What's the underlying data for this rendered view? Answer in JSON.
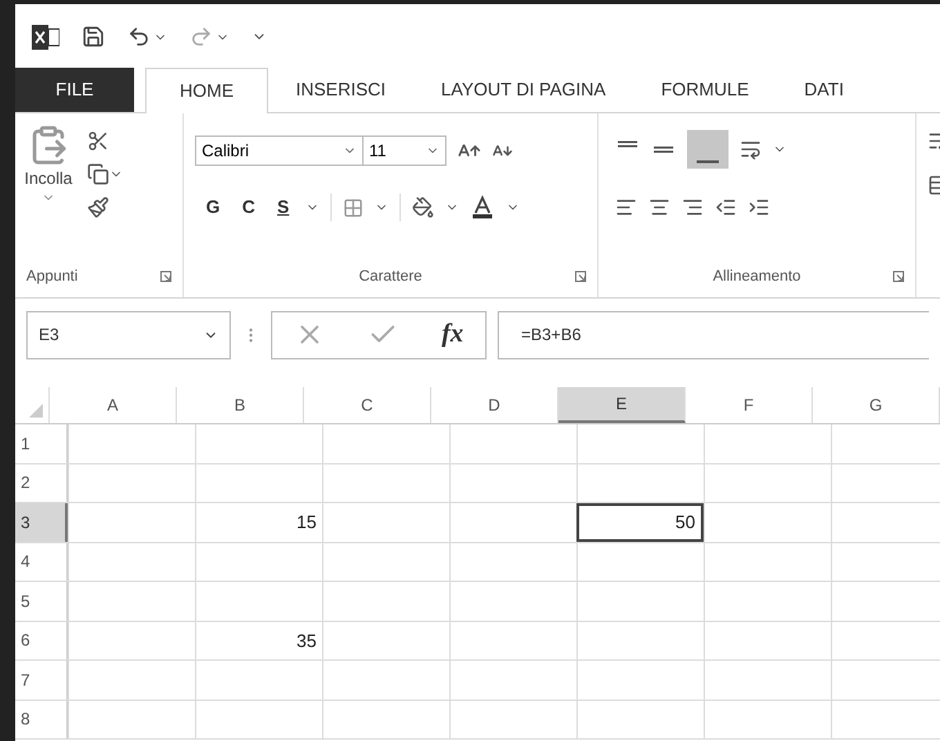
{
  "tabs": [
    {
      "label": "FILE",
      "kind": "file",
      "selected": false
    },
    {
      "label": "HOME",
      "kind": "tab",
      "selected": true
    },
    {
      "label": "INSERISCI",
      "kind": "tab",
      "selected": false
    },
    {
      "label": "LAYOUT DI PAGINA",
      "kind": "tab",
      "selected": false
    },
    {
      "label": "FORMULE",
      "kind": "tab",
      "selected": false
    },
    {
      "label": "DATI",
      "kind": "tab",
      "selected": false
    }
  ],
  "ribbon": {
    "paste_label": "Incolla",
    "font_name": "Calibri",
    "font_size": "11",
    "bold": "G",
    "italic": "C",
    "underline": "S",
    "groups": [
      "Appunti",
      "Carattere",
      "Allineamento"
    ]
  },
  "formula_bar": {
    "name_box": "E3",
    "fx": "fx",
    "formula": "=B3+B6"
  },
  "columns": [
    {
      "label": "A",
      "selected": false
    },
    {
      "label": "B",
      "selected": false
    },
    {
      "label": "C",
      "selected": false
    },
    {
      "label": "D",
      "selected": false
    },
    {
      "label": "E",
      "selected": true
    },
    {
      "label": "F",
      "selected": false
    },
    {
      "label": "G",
      "selected": false
    }
  ],
  "rows": [
    {
      "label": "1",
      "selected": false,
      "cells": [
        {
          "selected": false
        },
        {
          "selected": false
        },
        {
          "selected": false
        },
        {
          "selected": false
        },
        {
          "selected": false
        },
        {
          "selected": false
        },
        {
          "selected": false
        }
      ]
    },
    {
      "label": "2",
      "selected": false,
      "cells": [
        {
          "selected": false
        },
        {
          "selected": false
        },
        {
          "selected": false
        },
        {
          "selected": false
        },
        {
          "selected": false
        },
        {
          "selected": false
        },
        {
          "selected": false
        }
      ]
    },
    {
      "label": "3",
      "selected": true,
      "cells": [
        {
          "selected": false
        },
        {
          "value": "15",
          "selected": false
        },
        {
          "selected": false
        },
        {
          "selected": false
        },
        {
          "value": "50",
          "selected": true
        },
        {
          "selected": false
        },
        {
          "selected": false
        }
      ]
    },
    {
      "label": "4",
      "selected": false,
      "cells": [
        {
          "selected": false
        },
        {
          "selected": false
        },
        {
          "selected": false
        },
        {
          "selected": false
        },
        {
          "selected": false
        },
        {
          "selected": false
        },
        {
          "selected": false
        }
      ]
    },
    {
      "label": "5",
      "selected": false,
      "cells": [
        {
          "selected": false
        },
        {
          "selected": false
        },
        {
          "selected": false
        },
        {
          "selected": false
        },
        {
          "selected": false
        },
        {
          "selected": false
        },
        {
          "selected": false
        }
      ]
    },
    {
      "label": "6",
      "selected": false,
      "cells": [
        {
          "selected": false
        },
        {
          "value": "35",
          "selected": false
        },
        {
          "selected": false
        },
        {
          "selected": false
        },
        {
          "selected": false
        },
        {
          "selected": false
        },
        {
          "selected": false
        }
      ]
    },
    {
      "label": "7",
      "selected": false,
      "cells": [
        {
          "selected": false
        },
        {
          "selected": false
        },
        {
          "selected": false
        },
        {
          "selected": false
        },
        {
          "selected": false
        },
        {
          "selected": false
        },
        {
          "selected": false
        }
      ]
    },
    {
      "label": "8",
      "selected": false,
      "cells": [
        {
          "selected": false
        },
        {
          "selected": false
        },
        {
          "selected": false
        },
        {
          "selected": false
        },
        {
          "selected": false
        },
        {
          "selected": false
        },
        {
          "selected": false
        }
      ]
    }
  ]
}
